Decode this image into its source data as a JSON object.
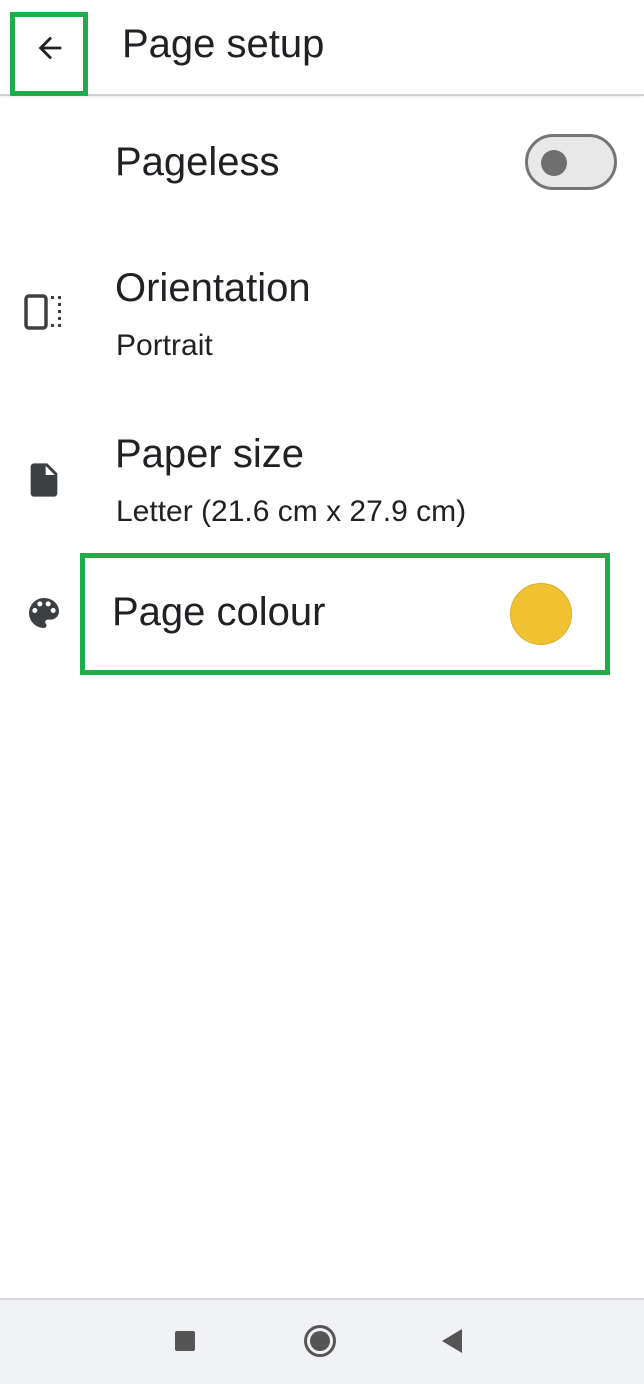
{
  "app_bar": {
    "title": "Page setup",
    "back_icon": "arrow-back-icon"
  },
  "settings": {
    "pageless": {
      "label": "Pageless",
      "enabled": false
    },
    "orientation": {
      "label": "Orientation",
      "value": "Portrait",
      "icon": "orientation-icon"
    },
    "paper_size": {
      "label": "Paper size",
      "value": "Letter (21.6 cm x 27.9 cm)",
      "icon": "document-icon"
    },
    "page_colour": {
      "label": "Page colour",
      "color": "#f0c131",
      "icon": "palette-icon"
    }
  },
  "highlight_color": "#1fac4b",
  "nav": {
    "recents_icon": "square-icon",
    "home_icon": "circle-icon",
    "back_icon": "triangle-back-icon"
  }
}
